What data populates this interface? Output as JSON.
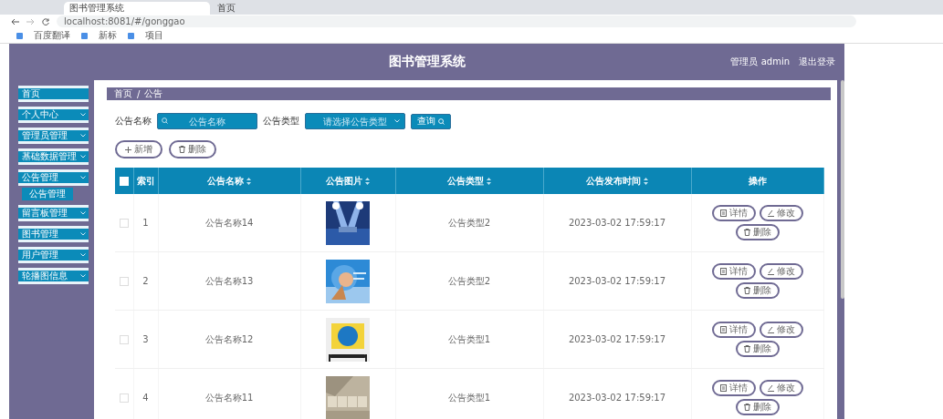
{
  "browser": {
    "tabs": [
      {
        "title": "图书管理系统",
        "selected": true
      },
      {
        "title": "首页",
        "selected": false
      }
    ],
    "url": "localhost:8081/#/gonggao",
    "bookmarks": [
      "百度翻译",
      "新标",
      "项目"
    ]
  },
  "header": {
    "title": "图书管理系统",
    "user": "管理员 admin",
    "logout": "退出登录"
  },
  "sidebar": {
    "items": [
      {
        "label": "首页",
        "kind": "link"
      },
      {
        "label": "个人中心",
        "kind": "submenu"
      },
      {
        "label": "管理员管理",
        "kind": "submenu"
      },
      {
        "label": "基础数据管理",
        "kind": "submenu"
      },
      {
        "label": "公告管理",
        "kind": "submenu",
        "children": [
          {
            "label": "公告管理",
            "selected": true
          }
        ]
      },
      {
        "label": "留言板管理",
        "kind": "submenu"
      },
      {
        "label": "图书管理",
        "kind": "submenu"
      },
      {
        "label": "用户管理",
        "kind": "submenu"
      },
      {
        "label": "轮播图信息",
        "kind": "submenu"
      }
    ]
  },
  "breadcrumb": [
    "首页",
    "/",
    "公告"
  ],
  "search": {
    "name_label": "公告名称",
    "name_placeholder": "公告名称",
    "type_label": "公告类型",
    "type_placeholder": "请选择公告类型",
    "button": "查询"
  },
  "actions": [
    {
      "label": "新增",
      "kind": "add"
    },
    {
      "label": "删除",
      "kind": "delete"
    }
  ],
  "table": {
    "all_checked": false,
    "columns": [
      {
        "label": "索引",
        "sortable": false
      },
      {
        "label": "公告名称",
        "sortable": true
      },
      {
        "label": "公告图片",
        "sortable": true
      },
      {
        "label": "公告类型",
        "sortable": true
      },
      {
        "label": "公告发布时间",
        "sortable": true
      },
      {
        "label": "操作",
        "sortable": false
      }
    ],
    "rows": [
      {
        "checked": false,
        "index": "1",
        "name": "公告名称14",
        "image": {
          "kind": "picture"
        },
        "type": "公告类型2",
        "time": "2023-03-02 17:59:17",
        "buttons": [
          {
            "label": "详情",
            "kind": "view"
          },
          {
            "label": "修改",
            "kind": "edit"
          },
          {
            "label": "删除",
            "kind": "delete"
          }
        ]
      },
      {
        "checked": false,
        "index": "2",
        "name": "公告名称13",
        "image": {
          "kind": "picture"
        },
        "type": "公告类型2",
        "time": "2023-03-02 17:59:17",
        "buttons": [
          {
            "label": "详情",
            "kind": "view"
          },
          {
            "label": "修改",
            "kind": "edit"
          },
          {
            "label": "删除",
            "kind": "delete"
          }
        ]
      },
      {
        "checked": false,
        "index": "3",
        "name": "公告名称12",
        "image": {
          "kind": "picture"
        },
        "type": "公告类型1",
        "time": "2023-03-02 17:59:17",
        "buttons": [
          {
            "label": "详情",
            "kind": "view"
          },
          {
            "label": "修改",
            "kind": "edit"
          },
          {
            "label": "删除",
            "kind": "delete"
          }
        ]
      },
      {
        "checked": false,
        "index": "4",
        "name": "公告名称11",
        "image": {
          "kind": "picture"
        },
        "type": "公告类型1",
        "time": "2023-03-02 17:59:17",
        "buttons": [
          {
            "label": "详情",
            "kind": "view"
          },
          {
            "label": "修改",
            "kind": "edit"
          },
          {
            "label": "删除",
            "kind": "delete"
          }
        ]
      }
    ]
  }
}
